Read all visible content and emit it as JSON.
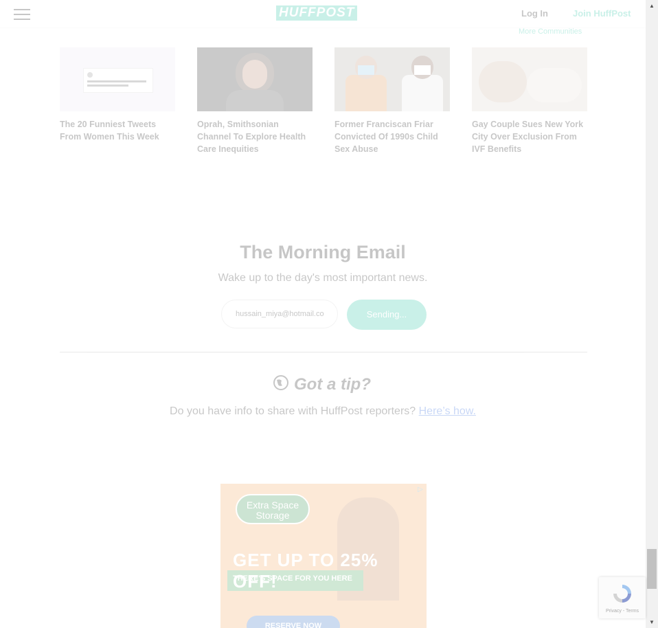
{
  "header": {
    "logo": "HUFFPOST",
    "login_label": "Log In",
    "join_label": "Join HuffPost",
    "more_communities": "More Communities"
  },
  "related": [
    {
      "title": "The 20 Funniest Tweets From Women This Week"
    },
    {
      "title": "Oprah, Smithsonian Channel To Explore Health Care Inequities"
    },
    {
      "title": "Former Franciscan Friar Convicted Of 1990s Child Sex Abuse"
    },
    {
      "title": "Gay Couple Sues New York City Over Exclusion From IVF Benefits"
    }
  ],
  "newsletter": {
    "title": "The Morning Email",
    "subtitle": "Wake up to the day's most important news.",
    "email_value": "hussain_miya@hotmail.co",
    "button_label": "Sending..."
  },
  "tip": {
    "title": "Got a tip?",
    "text": "Do you have info to share with HuffPost reporters?",
    "link": "Here’s how."
  },
  "ad": {
    "brand": "Extra Space Storage",
    "headline": "GET UP TO 25% OFF!",
    "sub": "THERE'S SPACE FOR YOU HERE",
    "cta": "RESERVE NOW"
  },
  "recaptcha": {
    "text": "Privacy - Terms"
  },
  "colors": {
    "brand": "#0dbe98",
    "link": "#0b4fd8"
  }
}
